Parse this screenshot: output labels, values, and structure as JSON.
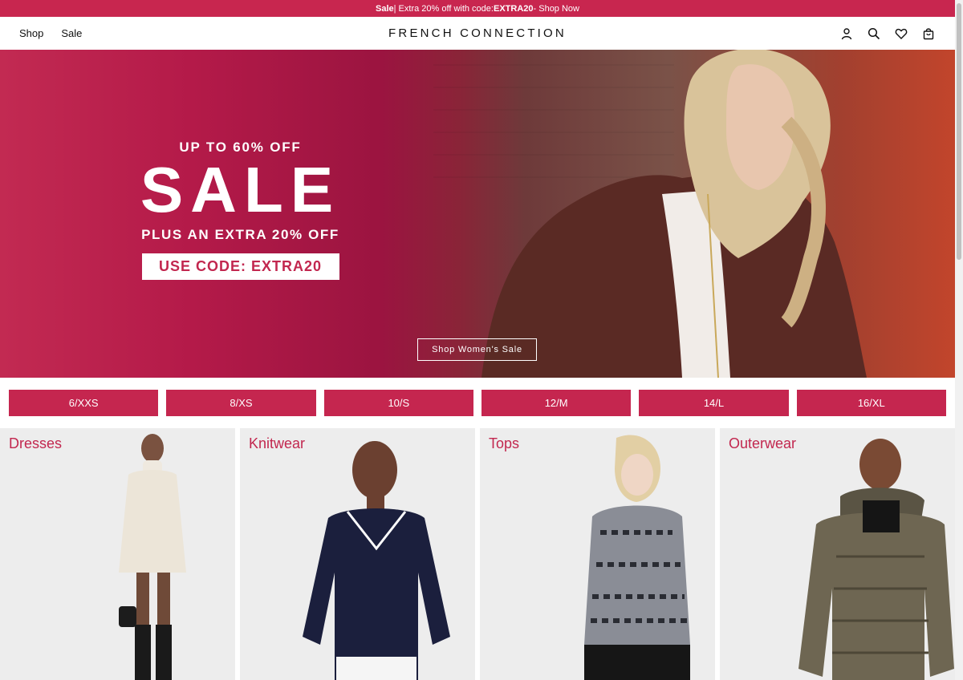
{
  "promo": {
    "bold": "Sale",
    "text": " | Extra 20% off with code: ",
    "code": "EXTRA20",
    "link": " - Shop Now"
  },
  "header": {
    "nav": [
      "Shop",
      "Sale"
    ],
    "logo": "FRENCH CONNECTION",
    "icons": [
      "account-icon",
      "search-icon",
      "wishlist-heart-icon",
      "bag-icon"
    ]
  },
  "hero": {
    "line1": "UP TO 60% OFF",
    "headline": "SALE",
    "line2": "PLUS AN EXTRA 20% OFF",
    "code_label": "USE CODE: EXTRA20",
    "cta": "Shop Women's Sale"
  },
  "sizes": [
    "6/XXS",
    "8/XS",
    "10/S",
    "12/M",
    "14/L",
    "16/XL"
  ],
  "categories": [
    "Dresses",
    "Knitwear",
    "Tops",
    "Outerwear"
  ],
  "colors": {
    "brand": "#c5264f",
    "background": "#ffffff",
    "tile": "#ededed"
  }
}
